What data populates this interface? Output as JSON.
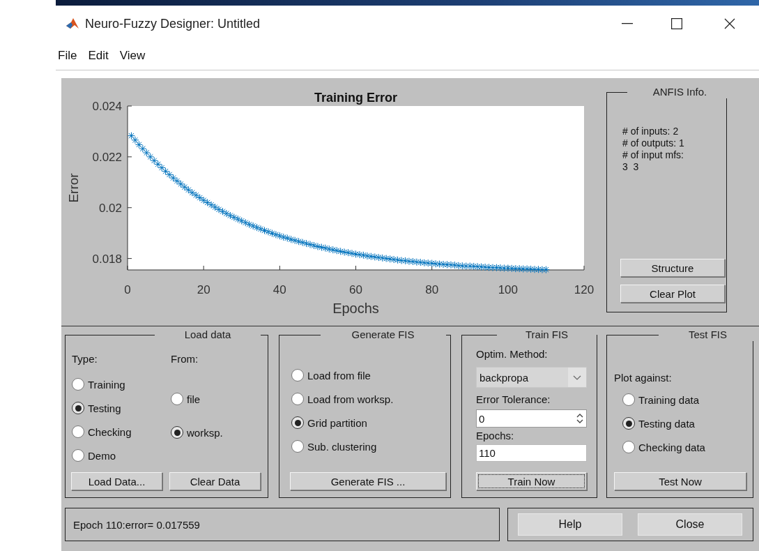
{
  "window": {
    "title": "Neuro-Fuzzy Designer: Untitled"
  },
  "menu": [
    "File",
    "Edit",
    "View"
  ],
  "training_plot": {
    "chart_data": {
      "type": "scatter",
      "title": "Training Error",
      "xlabel": "Epochs",
      "ylabel": "Error",
      "x": [
        1,
        2,
        3,
        4,
        5,
        6,
        7,
        8,
        9,
        10,
        11,
        12,
        13,
        14,
        15,
        16,
        17,
        18,
        19,
        20,
        21,
        22,
        23,
        24,
        25,
        26,
        27,
        28,
        29,
        30,
        31,
        32,
        33,
        34,
        35,
        36,
        37,
        38,
        39,
        40,
        41,
        42,
        43,
        44,
        45,
        46,
        47,
        48,
        49,
        50,
        51,
        52,
        53,
        54,
        55,
        56,
        57,
        58,
        59,
        60,
        61,
        62,
        63,
        64,
        65,
        66,
        67,
        68,
        69,
        70,
        71,
        72,
        73,
        74,
        75,
        76,
        77,
        78,
        79,
        80,
        81,
        82,
        83,
        84,
        85,
        86,
        87,
        88,
        89,
        90,
        91,
        92,
        93,
        94,
        95,
        96,
        97,
        98,
        99,
        100,
        101,
        102,
        103,
        104,
        105,
        106,
        107,
        108,
        109,
        110
      ],
      "series": [
        {
          "color": "#0072bd",
          "marker": "cross",
          "values": [
            0.02283,
            0.02266,
            0.02248,
            0.02232,
            0.02216,
            0.022,
            0.02185,
            0.02171,
            0.02157,
            0.02143,
            0.0213,
            0.02117,
            0.02105,
            0.02093,
            0.02081,
            0.0207,
            0.02059,
            0.02049,
            0.02039,
            0.02029,
            0.0202,
            0.02011,
            0.02002,
            0.01993,
            0.01985,
            0.01977,
            0.01969,
            0.01962,
            0.01955,
            0.01948,
            0.01941,
            0.01934,
            0.01928,
            0.01922,
            0.01916,
            0.0191,
            0.01905,
            0.01899,
            0.01894,
            0.01889,
            0.01884,
            0.0188,
            0.01875,
            0.01871,
            0.01867,
            0.01863,
            0.01859,
            0.01855,
            0.01851,
            0.01847,
            0.01844,
            0.01841,
            0.01837,
            0.01834,
            0.01831,
            0.01828,
            0.01825,
            0.01823,
            0.0182,
            0.01817,
            0.01815,
            0.01813,
            0.0181,
            0.01808,
            0.01806,
            0.01804,
            0.01802,
            0.018,
            0.01798,
            0.01796,
            0.01794,
            0.01792,
            0.01791,
            0.01789,
            0.01788,
            0.01786,
            0.01785,
            0.01783,
            0.01782,
            0.01781,
            0.01779,
            0.01778,
            0.01777,
            0.01776,
            0.01775,
            0.01774,
            0.01772,
            0.01771,
            0.0177,
            0.0177,
            0.01769,
            0.01768,
            0.01767,
            0.01766,
            0.01765,
            0.01764,
            0.01764,
            0.01763,
            0.01762,
            0.01762,
            0.01761,
            0.0176,
            0.0176,
            0.01759,
            0.01759,
            0.01758,
            0.01757,
            0.01757,
            0.01756,
            0.01756
          ]
        }
      ],
      "xlim": [
        0,
        120
      ],
      "ylim": [
        0.01755,
        0.024
      ],
      "xticks": [
        0,
        20,
        40,
        60,
        80,
        100,
        120
      ],
      "yticks": [
        0.018,
        0.02,
        0.022,
        0.024
      ]
    }
  },
  "anfis_info": {
    "title": "ANFIS Info.",
    "lines": [
      "# of inputs: 2",
      "# of outputs: 1",
      "# of input mfs:",
      "3  3"
    ],
    "buttons": [
      "Structure",
      "Clear Plot"
    ]
  },
  "load_data": {
    "title": "Load data",
    "type_label": "Type:",
    "from_label": "From:",
    "type_options": [
      {
        "label": "Training",
        "selected": false
      },
      {
        "label": "Testing",
        "selected": true
      },
      {
        "label": "Checking",
        "selected": false
      },
      {
        "label": "Demo",
        "selected": false
      }
    ],
    "from_options": [
      {
        "label": "file",
        "selected": false
      },
      {
        "label": "worksp.",
        "selected": true
      }
    ],
    "buttons": [
      "Load Data...",
      "Clear Data"
    ]
  },
  "generate_fis": {
    "title": "Generate FIS",
    "options": [
      {
        "label": "Load from file",
        "selected": false
      },
      {
        "label": "Load from worksp.",
        "selected": false
      },
      {
        "label": "Grid partition",
        "selected": true
      },
      {
        "label": "Sub. clustering",
        "selected": false
      }
    ],
    "button": "Generate FIS ..."
  },
  "train_fis": {
    "title": "Train FIS",
    "method_label": "Optim. Method:",
    "method": "backpropa",
    "tolerance_label": "Error Tolerance:",
    "tolerance": "0",
    "epochs_label": "Epochs:",
    "epochs": "110",
    "button": {
      "label": "Train Now",
      "focused": true
    }
  },
  "test_fis": {
    "title": "Test FIS",
    "plot_label": "Plot against:",
    "options": [
      {
        "label": "Training data",
        "selected": false
      },
      {
        "label": "Testing data",
        "selected": true
      },
      {
        "label": "Checking data",
        "selected": false
      }
    ],
    "button": "Test Now"
  },
  "status": "Epoch 110:error= 0.017559",
  "buttons": [
    "Help",
    "Close"
  ]
}
